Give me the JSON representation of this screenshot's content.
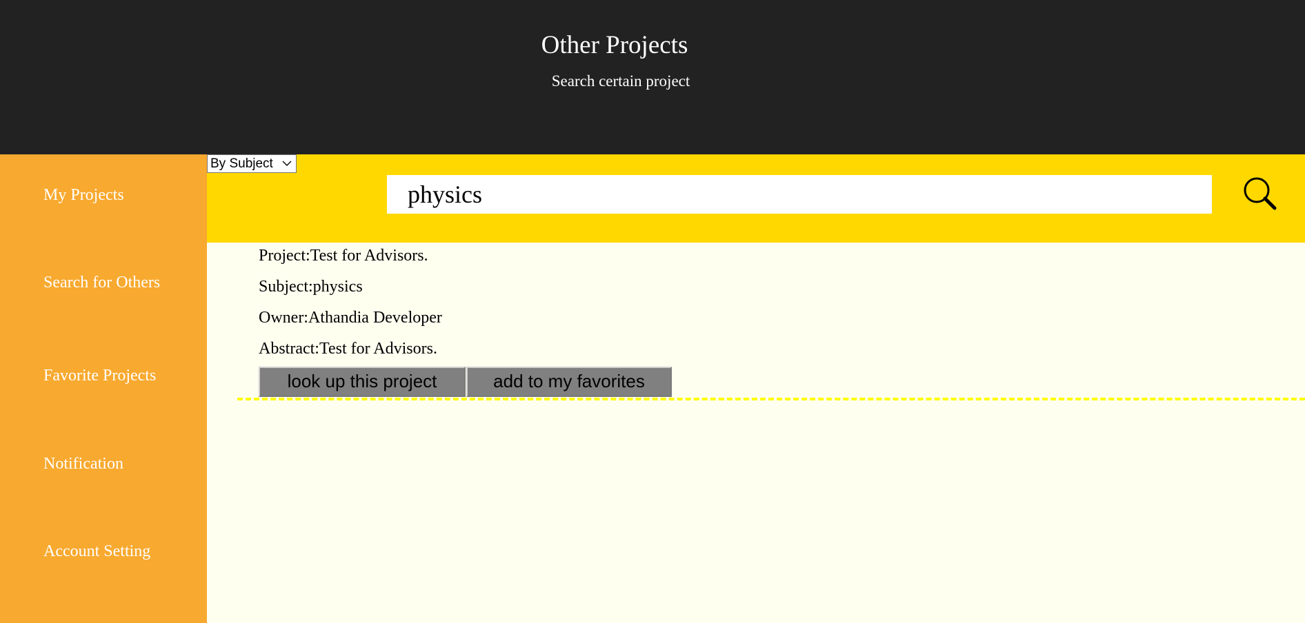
{
  "header": {
    "title": "Other Projects",
    "subtitle": "Search certain project"
  },
  "sidebar": {
    "items": [
      {
        "label": "My Projects"
      },
      {
        "label": "Search for Others"
      },
      {
        "label": "Favorite Projects"
      },
      {
        "label": "Notification"
      },
      {
        "label": "Account Setting"
      }
    ]
  },
  "search": {
    "filter_selected": "By Subject",
    "query": "physics",
    "search_icon": "search-icon"
  },
  "results": [
    {
      "project": "Project:Test for Advisors.",
      "subject": "Subject:physics",
      "owner": "Owner:Athandia Developer",
      "abstract": "Abstract:Test for Advisors.",
      "lookup_label": "look up this project",
      "favorite_label": "add to my favorites"
    }
  ],
  "colors": {
    "header_bg": "#222222",
    "sidebar_bg": "#f8a92f",
    "searchbar_bg": "#ffd800",
    "content_bg": "#fffff0",
    "divider": "#ffff00",
    "button_bg": "#808080"
  }
}
